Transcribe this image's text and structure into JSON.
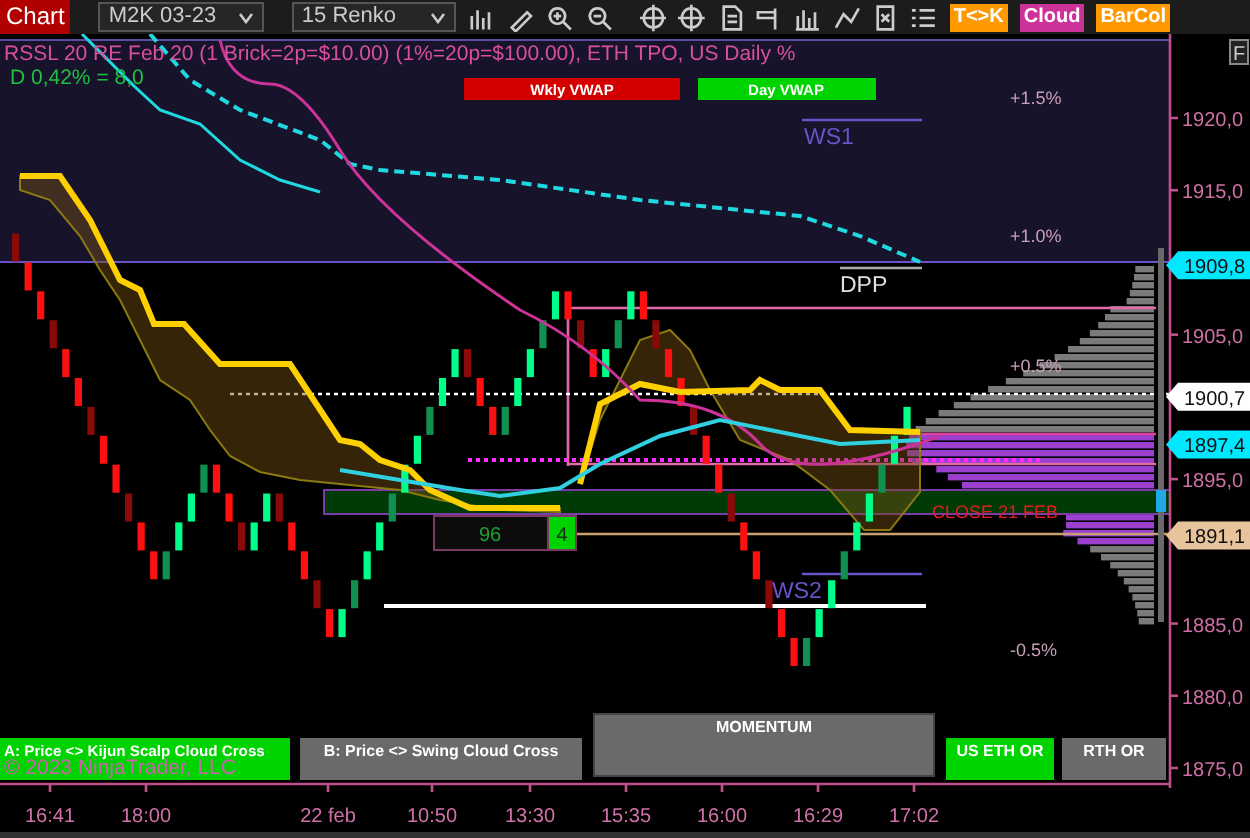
{
  "toolbar": {
    "title": "Chart",
    "instrument": "M2K 03-23",
    "bar_type": "15 Renko",
    "toggles": [
      {
        "label": "T<>K",
        "color": "#ff9900"
      },
      {
        "label": "Cloud",
        "color": "#cc3399"
      },
      {
        "label": "BarCol",
        "color": "#ff9900"
      }
    ]
  },
  "chart": {
    "header": "RSSL 20 RE Feb 20 (1 Brick=2p=$10.00) (1%=20p=$100.00), ETH TPO, US Daily %",
    "subheader": "D 0,42% = 8,0",
    "vwap_tags": [
      {
        "label": "Wkly VWAP",
        "color": "#d40000"
      },
      {
        "label": "Day VWAP",
        "color": "#00d400"
      }
    ],
    "percent_levels": [
      "+1.5%",
      "+1.0%",
      "+0.5%",
      "-0.5%"
    ],
    "pivots": [
      "WS1",
      "DPP",
      "WS2"
    ],
    "close_label": "CLOSE 21 FEB",
    "counter": {
      "value": "96",
      "count": "4"
    },
    "signal_buttons": [
      {
        "label": "A: Price <> Kijun Scalp Cloud Cross",
        "color": "#00d400"
      },
      {
        "label": "B: Price <> Swing Cloud Cross",
        "color": "#6a6a6a"
      },
      {
        "label": "MOMENTUM",
        "color": "#6a6a6a"
      },
      {
        "label": "US ETH OR",
        "color": "#00d400"
      },
      {
        "label": "RTH OR",
        "color": "#6a6a6a"
      }
    ],
    "copyright": "© 2023 NinjaTrader, LLC"
  },
  "price_axis": {
    "button": "F",
    "ticks": [
      "1920,0",
      "1915,0",
      "1905,0",
      "1895,0",
      "1885,0",
      "1880,0",
      "1875,0"
    ],
    "markers": [
      {
        "text": "1909,8",
        "color": "#00e8ff"
      },
      {
        "text": "1900,7",
        "color": "#ffffff"
      },
      {
        "text": "1897,4",
        "color": "#00e8ff"
      },
      {
        "text": "1891,1",
        "color": "#e8c49c"
      }
    ]
  },
  "time_axis": {
    "ticks": [
      "16:41",
      "18:00",
      "22 feb",
      "10:50",
      "13:30",
      "15:35",
      "16:00",
      "16:29",
      "17:02"
    ]
  }
}
